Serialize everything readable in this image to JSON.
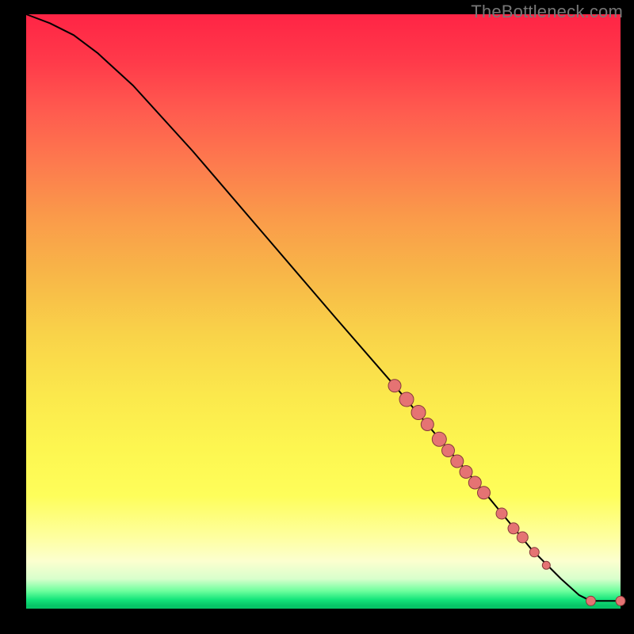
{
  "watermark": "TheBottleneck.com",
  "colors": {
    "point_fill": "#e57373",
    "point_stroke": "#863a3a",
    "curve": "#000000"
  },
  "chart_data": {
    "type": "line",
    "title": "",
    "xlabel": "",
    "ylabel": "",
    "xlim": [
      0,
      100
    ],
    "ylim": [
      0,
      100
    ],
    "grid": false,
    "legend": false,
    "curve": [
      {
        "x": 0,
        "y": 100
      },
      {
        "x": 4,
        "y": 98.5
      },
      {
        "x": 8,
        "y": 96.5
      },
      {
        "x": 12,
        "y": 93.5
      },
      {
        "x": 18,
        "y": 88
      },
      {
        "x": 28,
        "y": 77
      },
      {
        "x": 40,
        "y": 63
      },
      {
        "x": 52,
        "y": 49
      },
      {
        "x": 62,
        "y": 37.5
      },
      {
        "x": 70,
        "y": 28
      },
      {
        "x": 78,
        "y": 18.5
      },
      {
        "x": 85,
        "y": 10
      },
      {
        "x": 90,
        "y": 5
      },
      {
        "x": 93,
        "y": 2.3
      },
      {
        "x": 95,
        "y": 1.3
      },
      {
        "x": 100,
        "y": 1.3
      }
    ],
    "points": [
      {
        "x": 62,
        "y": 37.5,
        "r": 8
      },
      {
        "x": 64,
        "y": 35.2,
        "r": 9
      },
      {
        "x": 66,
        "y": 33,
        "r": 9
      },
      {
        "x": 67.5,
        "y": 31,
        "r": 8
      },
      {
        "x": 69.5,
        "y": 28.5,
        "r": 9
      },
      {
        "x": 71,
        "y": 26.6,
        "r": 8
      },
      {
        "x": 72.5,
        "y": 24.8,
        "r": 8
      },
      {
        "x": 74,
        "y": 23,
        "r": 8
      },
      {
        "x": 75.5,
        "y": 21.2,
        "r": 8
      },
      {
        "x": 77,
        "y": 19.5,
        "r": 8
      },
      {
        "x": 80,
        "y": 16,
        "r": 7
      },
      {
        "x": 82,
        "y": 13.5,
        "r": 7
      },
      {
        "x": 83.5,
        "y": 12,
        "r": 7
      },
      {
        "x": 85.5,
        "y": 9.5,
        "r": 6
      },
      {
        "x": 87.5,
        "y": 7.3,
        "r": 5
      },
      {
        "x": 95,
        "y": 1.3,
        "r": 6
      },
      {
        "x": 100,
        "y": 1.3,
        "r": 6
      }
    ]
  }
}
